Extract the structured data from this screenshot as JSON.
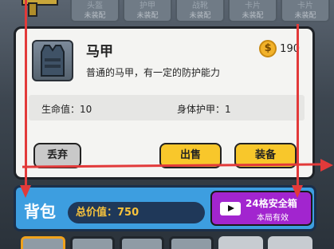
{
  "slots": [
    {
      "label": "头盔",
      "sub": "未装配"
    },
    {
      "label": "护甲",
      "sub": "未装配"
    },
    {
      "label": "战靴",
      "sub": "未装配"
    },
    {
      "label": "卡片",
      "sub": "未装配"
    },
    {
      "label": "卡片",
      "sub": "未装配"
    }
  ],
  "item": {
    "name": "马甲",
    "price": "190",
    "description": "普通的马甲，有一定的防护能力",
    "stat_hp": "生命值：10",
    "stat_armor": "身体护甲：1",
    "discard_label": "丢弃",
    "sell_label": "出售",
    "equip_label": "装备"
  },
  "backpack": {
    "title": "背包",
    "total_value": "总价值：750",
    "safe_box_title": "24格安全箱",
    "safe_box_sub": "本局有效"
  },
  "colors": {
    "card_bg": "#f4f4f2",
    "action_yellow": "#f8c72b",
    "bag_blue": "#3d9ee0",
    "safe_purple": "#a225cf",
    "arrow_red": "#e23a3a"
  }
}
